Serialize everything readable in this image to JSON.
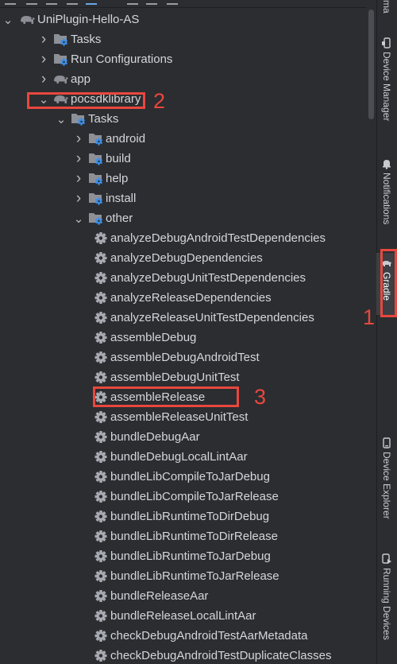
{
  "colors": {
    "background": "#2b2d30",
    "text": "#d4d6db",
    "annotation": "#e8473f",
    "gear": "#a7aab1",
    "folder": "#8e9098",
    "module": "#8b8e95",
    "badge": "#3d8ee6"
  },
  "tree": [
    {
      "level": 0,
      "state": "expanded",
      "icon": "gradle-elephant-icon",
      "label": "UniPlugin-Hello-AS"
    },
    {
      "level": 1,
      "state": "collapsed",
      "icon": "folder-gear-icon",
      "label": "Tasks"
    },
    {
      "level": 1,
      "state": "collapsed",
      "icon": "folder-gear-icon",
      "label": "Run Configurations"
    },
    {
      "level": 1,
      "state": "collapsed",
      "icon": "gradle-elephant-icon",
      "label": "app"
    },
    {
      "level": 1,
      "state": "expanded",
      "icon": "gradle-elephant-icon",
      "label": "pocsdklibrary"
    },
    {
      "level": 2,
      "state": "expanded",
      "icon": "folder-gear-icon",
      "label": "Tasks"
    },
    {
      "level": 3,
      "state": "collapsed",
      "icon": "folder-gear-icon",
      "label": "android"
    },
    {
      "level": 3,
      "state": "collapsed",
      "icon": "folder-gear-icon",
      "label": "build"
    },
    {
      "level": 3,
      "state": "collapsed",
      "icon": "folder-gear-icon",
      "label": "help"
    },
    {
      "level": 3,
      "state": "collapsed",
      "icon": "folder-gear-icon",
      "label": "install"
    },
    {
      "level": 3,
      "state": "expanded",
      "icon": "folder-gear-icon",
      "label": "other"
    },
    {
      "level": 4,
      "state": "leaf",
      "icon": "gear-icon",
      "label": "analyzeDebugAndroidTestDependencies"
    },
    {
      "level": 4,
      "state": "leaf",
      "icon": "gear-icon",
      "label": "analyzeDebugDependencies"
    },
    {
      "level": 4,
      "state": "leaf",
      "icon": "gear-icon",
      "label": "analyzeDebugUnitTestDependencies"
    },
    {
      "level": 4,
      "state": "leaf",
      "icon": "gear-icon",
      "label": "analyzeReleaseDependencies"
    },
    {
      "level": 4,
      "state": "leaf",
      "icon": "gear-icon",
      "label": "analyzeReleaseUnitTestDependencies"
    },
    {
      "level": 4,
      "state": "leaf",
      "icon": "gear-icon",
      "label": "assembleDebug"
    },
    {
      "level": 4,
      "state": "leaf",
      "icon": "gear-icon",
      "label": "assembleDebugAndroidTest"
    },
    {
      "level": 4,
      "state": "leaf",
      "icon": "gear-icon",
      "label": "assembleDebugUnitTest"
    },
    {
      "level": 4,
      "state": "leaf",
      "icon": "gear-icon",
      "label": "assembleRelease"
    },
    {
      "level": 4,
      "state": "leaf",
      "icon": "gear-icon",
      "label": "assembleReleaseUnitTest"
    },
    {
      "level": 4,
      "state": "leaf",
      "icon": "gear-icon",
      "label": "bundleDebugAar"
    },
    {
      "level": 4,
      "state": "leaf",
      "icon": "gear-icon",
      "label": "bundleDebugLocalLintAar"
    },
    {
      "level": 4,
      "state": "leaf",
      "icon": "gear-icon",
      "label": "bundleLibCompileToJarDebug"
    },
    {
      "level": 4,
      "state": "leaf",
      "icon": "gear-icon",
      "label": "bundleLibCompileToJarRelease"
    },
    {
      "level": 4,
      "state": "leaf",
      "icon": "gear-icon",
      "label": "bundleLibRuntimeToDirDebug"
    },
    {
      "level": 4,
      "state": "leaf",
      "icon": "gear-icon",
      "label": "bundleLibRuntimeToDirRelease"
    },
    {
      "level": 4,
      "state": "leaf",
      "icon": "gear-icon",
      "label": "bundleLibRuntimeToJarDebug"
    },
    {
      "level": 4,
      "state": "leaf",
      "icon": "gear-icon",
      "label": "bundleLibRuntimeToJarRelease"
    },
    {
      "level": 4,
      "state": "leaf",
      "icon": "gear-icon",
      "label": "bundleReleaseAar"
    },
    {
      "level": 4,
      "state": "leaf",
      "icon": "gear-icon",
      "label": "bundleReleaseLocalLintAar"
    },
    {
      "level": 4,
      "state": "leaf",
      "icon": "gear-icon",
      "label": "checkDebugAndroidTestAarMetadata"
    },
    {
      "level": 4,
      "state": "leaf",
      "icon": "gear-icon",
      "label": "checkDebugAndroidTestDuplicateClasses"
    }
  ],
  "right_tabs": {
    "top_partial": "ma",
    "device_manager": "Device Manager",
    "notifications": "Notifications",
    "gradle": "Gradle",
    "device_explorer": "Device Explorer",
    "running_devices": "Running Devices"
  },
  "annotations": {
    "gradle_tab_number": "1",
    "module_number": "2",
    "task_number": "3"
  }
}
